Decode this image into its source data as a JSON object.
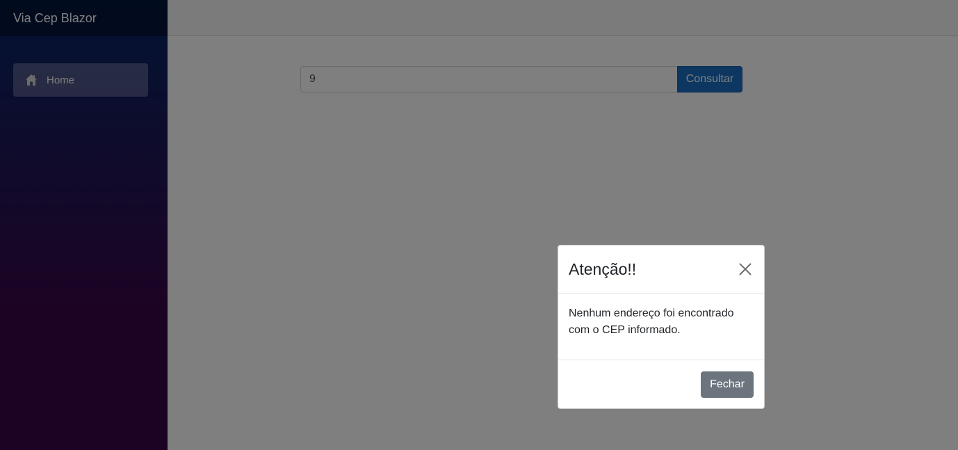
{
  "app": {
    "brand": "Via Cep Blazor"
  },
  "sidebar": {
    "items": [
      {
        "label": "Home",
        "icon": "home-icon",
        "active": true
      }
    ]
  },
  "search": {
    "value": "9",
    "button_label": "Consultar"
  },
  "modal": {
    "title": "Atenção!!",
    "close_icon": "close-icon",
    "message": "Nenhum endereço foi encontrado com o CEP informado.",
    "close_button_label": "Fechar"
  },
  "colors": {
    "primary": "#1b6ec2",
    "secondary": "#6c757d",
    "sidebar_top": "#052767",
    "sidebar_bottom": "#3a0647"
  }
}
